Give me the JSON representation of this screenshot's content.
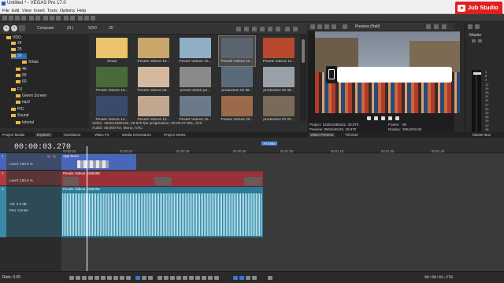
{
  "title": "Untitled * - VEGAS Pro 17.0",
  "menu": [
    "File",
    "Edit",
    "View",
    "Insert",
    "Tools",
    "Options",
    "Help"
  ],
  "watermark": "Jub Studio",
  "explorer": {
    "crumbs": [
      "Computer",
      "(D:)",
      "VDO",
      "30"
    ],
    "tree": [
      {
        "label": "VDO",
        "level": 0
      },
      {
        "label": "24",
        "level": 1
      },
      {
        "label": "25",
        "level": 1
      },
      {
        "label": "30",
        "level": 1,
        "selected": true
      },
      {
        "label": "Xmas",
        "level": 2
      },
      {
        "label": "4K",
        "level": 1
      },
      {
        "label": "50",
        "level": 1
      },
      {
        "label": "60",
        "level": 1
      },
      {
        "label": "FX",
        "level": 1
      },
      {
        "label": "Green Screen",
        "level": 1
      },
      {
        "label": "mp3",
        "level": 1
      },
      {
        "label": "PIC",
        "level": 1
      },
      {
        "label": "Sound",
        "level": 1
      },
      {
        "label": "tutorial",
        "level": 1
      }
    ],
    "files": [
      {
        "label": "Xmas",
        "color": "#e9c46a"
      },
      {
        "label": "Pexels Videos 10...",
        "color": "#c9a76a"
      },
      {
        "label": "Pexels Videos 10...",
        "color": "#8fb0c4"
      },
      {
        "label": "Pexels Videos 11...",
        "color": "#5b6470",
        "selected": true
      },
      {
        "label": "Pexels Videos 11...",
        "color": "#b8482e"
      },
      {
        "label": "Pexels Videos 13...",
        "color": "#4a6a3a"
      },
      {
        "label": "Pexels Videos 23...",
        "color": "#d4b8a0"
      },
      {
        "label": "pexels-artem-po...",
        "color": "#8a8a8a"
      },
      {
        "label": "production ID 38...",
        "color": "#5a6a7a"
      },
      {
        "label": "production ID 38...",
        "color": "#9aa0a8"
      },
      {
        "label": "Pexels Videos 13...",
        "color": "#3a4a6a"
      },
      {
        "label": "Pexels Videos 13...",
        "color": "#c0a890"
      },
      {
        "label": "Pexels Videos 10...",
        "color": "#6a7a8a"
      },
      {
        "label": "Pexels Videos 20...",
        "color": "#9a6a4a"
      },
      {
        "label": "production ID 40...",
        "color": "#7a6a5a"
      }
    ],
    "info_video": "Video: 1920x1080x32, 29.970 fps progressive, 00:00:27.661, AVC",
    "info_audio": "Audio: 48,000 Hz, Mono, AAC"
  },
  "preview": {
    "label": "Preview (Half)",
    "project": "Project:  1920x1080x32, 29.970",
    "preview_res": "Preview:  960x540x32, 29.970",
    "frame_label": "Frame:",
    "frame": "98",
    "display_label": "Display:",
    "display": "355x201x32"
  },
  "master": {
    "label": "Master",
    "scale": [
      "3",
      "6",
      "9",
      "12",
      "15",
      "18",
      "21",
      "24",
      "27",
      "30",
      "33",
      "36",
      "39",
      "42",
      "45",
      "48",
      "51",
      "54",
      "57"
    ]
  },
  "tabs": [
    "Project Media",
    "Explorer",
    "Transitions",
    "Video FX",
    "Media Generators",
    "Project Notes",
    "Video Preview",
    "Trimmer",
    "Master Bus"
  ],
  "timeline": {
    "timecode": "00:00:03.270",
    "marker": "+27.661",
    "ticks": [
      "00:00:00",
      "00:00:15",
      "00:00:30",
      "00:00:45",
      "00:01:00",
      "00:01:15",
      "00:01:30",
      "00:01:45"
    ],
    "tracks": [
      {
        "num": "1",
        "level": "Level: 100.0 %",
        "clip": "App Store",
        "color": "#4a66b8"
      },
      {
        "num": "2",
        "level": "Level: 100.0 %",
        "clip": "Pexels Videos 1168455",
        "color": "#b23a40"
      },
      {
        "num": "3",
        "vol": "Vol:  0.0 dB",
        "pan": "Pan:  Center",
        "clip": "Pexels Videos 1168455",
        "color": "#3a8aa6"
      }
    ]
  },
  "status": {
    "rate": "Rate: 0.00",
    "timecode": "00:00:03.270"
  }
}
